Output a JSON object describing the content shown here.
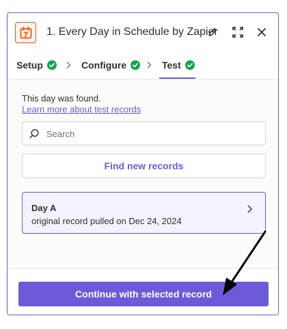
{
  "header": {
    "title": "1. Every Day in Schedule by Zapier",
    "app_icon": "calendar-schedule-icon",
    "edit_icon": "pencil-icon",
    "expand_icon": "expand-icon",
    "close_icon": "close-icon",
    "accent_color": "#ff4f00"
  },
  "steps": [
    {
      "label": "Setup",
      "status": "complete"
    },
    {
      "label": "Configure",
      "status": "complete"
    },
    {
      "label": "Test",
      "status": "complete",
      "active": true
    }
  ],
  "test": {
    "found_text": "This day was found.",
    "learn_link": "Learn more about test records",
    "search_placeholder": "Search",
    "search_value": "",
    "find_button": "Find new records"
  },
  "records": [
    {
      "title": "Day A",
      "subtitle": "original record pulled on Dec 24, 2024"
    }
  ],
  "footer": {
    "continue_button": "Continue with selected record"
  },
  "colors": {
    "brand": "#6b5bd9",
    "check": "#14a44d",
    "selected_bg": "#f4f2ff"
  }
}
